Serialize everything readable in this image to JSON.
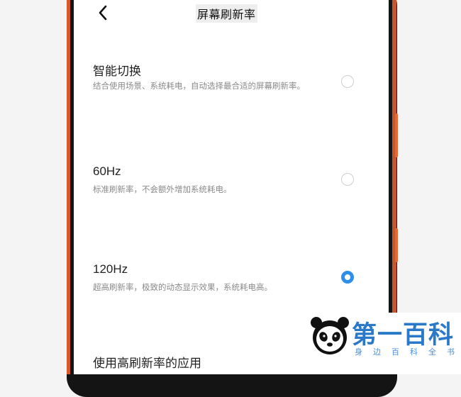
{
  "header": {
    "title": "屏幕刷新率"
  },
  "options": [
    {
      "title": "智能切换",
      "description": "结合使用场景、系统耗电，自动选择最合适的屏幕刷新率。",
      "selected": false
    },
    {
      "title": "60Hz",
      "description": "标准刷新率，不会额外增加系统耗电。",
      "selected": false
    },
    {
      "title": "120Hz",
      "description": "超高刷新率，极致的动态显示效果，系统耗电高。",
      "selected": true
    }
  ],
  "footer": {
    "label": "使用高刷新率的应用"
  },
  "watermark": {
    "title": "第一百科",
    "subtitle": "身边百科全书"
  },
  "colors": {
    "accent": "#2f8fe8",
    "phone_edge": "#d85a2a",
    "watermark_blue": "#2a78c8"
  },
  "icons": {
    "back": "chevron-left-icon",
    "radio": "radio-button-icon",
    "footer": "chevron-right-icon",
    "logo": "panda-logo-icon"
  }
}
